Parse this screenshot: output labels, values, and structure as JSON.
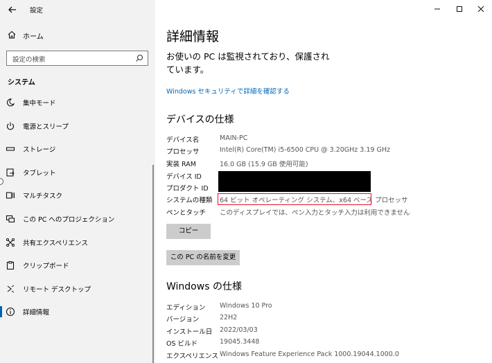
{
  "app": {
    "title": "設定"
  },
  "nav": {
    "home": "ホーム",
    "search_placeholder": "設定の検索",
    "section": "システム",
    "items": [
      {
        "label": "集中モード",
        "icon": "moon-icon"
      },
      {
        "label": "電源とスリープ",
        "icon": "power-icon"
      },
      {
        "label": "ストレージ",
        "icon": "storage-icon"
      },
      {
        "label": "タブレット",
        "icon": "tablet-icon"
      },
      {
        "label": "マルチタスク",
        "icon": "multitask-icon"
      },
      {
        "label": "この PC へのプロジェクション",
        "icon": "projection-icon"
      },
      {
        "label": "共有エクスペリエンス",
        "icon": "shared-experience-icon"
      },
      {
        "label": "クリップボード",
        "icon": "clipboard-icon"
      },
      {
        "label": "リモート デスクトップ",
        "icon": "remote-desktop-icon"
      },
      {
        "label": "詳細情報",
        "icon": "info-icon",
        "active": true
      }
    ]
  },
  "main": {
    "title": "詳細情報",
    "status": "お使いの PC は監視されており、保護されています。",
    "security_link": "Windows セキュリティで詳細を確認する",
    "device_specs": {
      "heading": "デバイスの仕様",
      "rows": [
        {
          "key": "デバイス名",
          "value": "MAIN-PC"
        },
        {
          "key": "プロセッサ",
          "value": "Intel(R) Core(TM) i5-6500 CPU @ 3.20GHz   3.19 GHz"
        },
        {
          "key": "実装 RAM",
          "value": "16.0 GB (15.9 GB 使用可能)"
        },
        {
          "key": "デバイス ID",
          "value": ""
        },
        {
          "key": "プロダクト ID",
          "value": ""
        },
        {
          "key": "システムの種類",
          "value": "64 ビット オペレーティング システム、x64 ベース プロセッサ"
        },
        {
          "key": "ペンとタッチ",
          "value": "このディスプレイでは、ペン入力とタッチ入力は利用できません"
        }
      ],
      "copy_button": "コピー",
      "rename_button": "この PC の名前を変更"
    },
    "windows_specs": {
      "heading": "Windows の仕様",
      "rows": [
        {
          "key": "エディション",
          "value": "Windows 10 Pro"
        },
        {
          "key": "バージョン",
          "value": "22H2"
        },
        {
          "key": "インストール日",
          "value": "2022/03/03"
        },
        {
          "key": "OS ビルド",
          "value": "19045.3448"
        },
        {
          "key": "エクスペリエンス",
          "value": "Windows Feature Experience Pack 1000.19044.1000.0"
        }
      ]
    }
  },
  "colors": {
    "accent": "#0063b1",
    "link": "#0067b8",
    "highlight": "#e81123"
  }
}
